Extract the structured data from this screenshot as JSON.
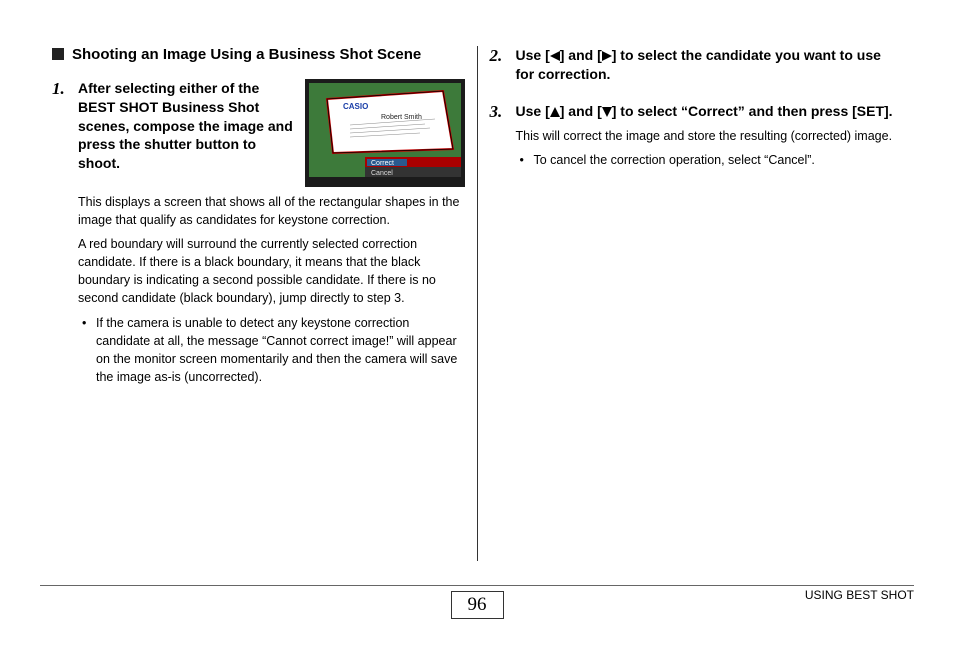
{
  "left": {
    "section_title": "Shooting an Image Using a Business Shot Scene",
    "step1": {
      "num": "1.",
      "title": "After selecting either of the BEST SHOT Business Shot scenes, compose the image and press the shutter button to shoot.",
      "para1": "This displays a screen that shows all of the rectangular shapes in the image that qualify as candidates for keystone correction.",
      "para2": "A red boundary will surround the currently selected correction candidate. If there is a black boundary, it means that the black boundary is indicating a second possible candidate. If there is no second candidate (black boundary), jump directly to step 3.",
      "bullet": "If the camera is unable to detect any keystone correction candidate at all, the message “Cannot correct image!” will appear on the monitor screen momentarily and then the camera will save the image as-is (uncorrected)."
    },
    "thumb": {
      "brand": "CASIO",
      "name": "Robert Smith",
      "opt_correct": "Correct",
      "opt_cancel": "Cancel"
    }
  },
  "right": {
    "step2": {
      "num": "2.",
      "before": "Use [",
      "mid": "] and [",
      "after": "] to select the candidate you want to use for correction."
    },
    "step3": {
      "num": "3.",
      "before": "Use [",
      "mid": "] and [",
      "after": "] to select “Correct” and then press [SET].",
      "para": "This will correct the image and store the resulting (corrected) image.",
      "bullet": "To cancel the correction operation, select “Cancel”."
    }
  },
  "footer": {
    "page": "96",
    "label": "USING BEST SHOT"
  }
}
